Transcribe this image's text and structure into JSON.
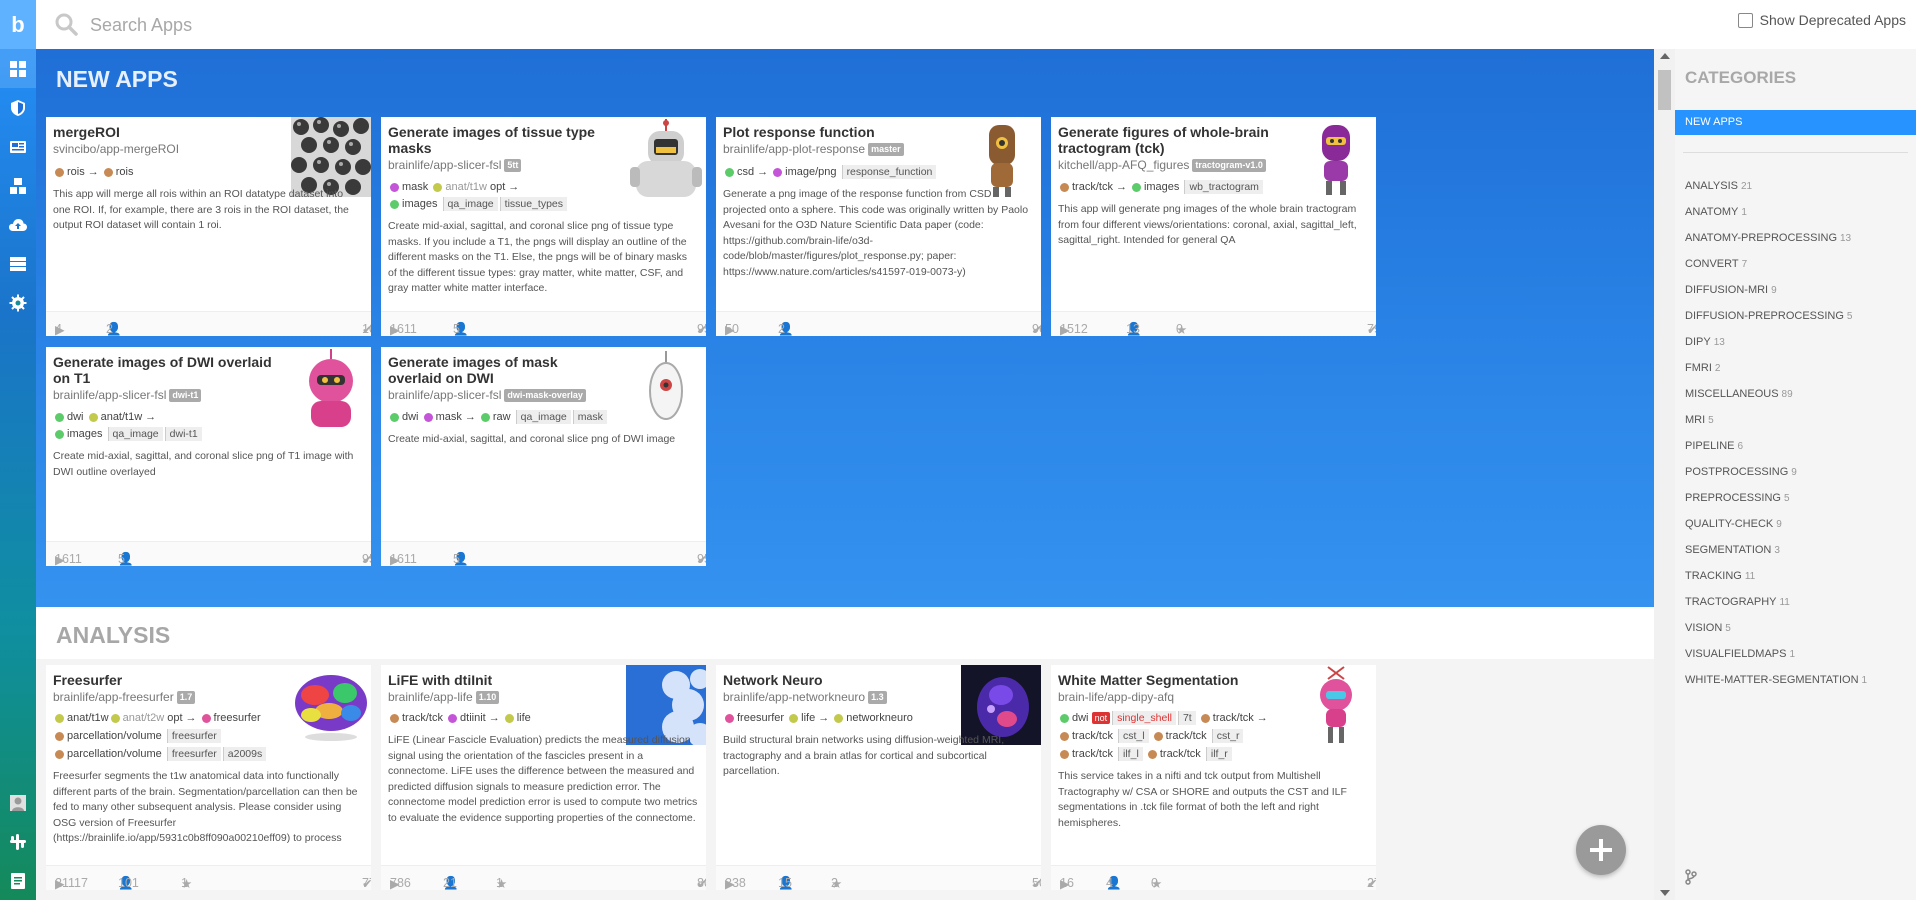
{
  "search": {
    "placeholder": "Search Apps"
  },
  "deprecated_label": "Show Deprecated Apps",
  "sections": {
    "new_apps": "NEW APPS",
    "analysis": "ANALYSIS"
  },
  "categories": {
    "title": "CATEGORIES",
    "selected": "NEW APPS",
    "items": [
      {
        "name": "ANALYSIS",
        "count": "21"
      },
      {
        "name": "ANATOMY",
        "count": "1"
      },
      {
        "name": "ANATOMY-PREPROCESSING",
        "count": "13"
      },
      {
        "name": "CONVERT",
        "count": "7"
      },
      {
        "name": "DIFFUSION-MRI",
        "count": "9"
      },
      {
        "name": "DIFFUSION-PREPROCESSING",
        "count": "5"
      },
      {
        "name": "DIPY",
        "count": "13"
      },
      {
        "name": "FMRI",
        "count": "2"
      },
      {
        "name": "MISCELLANEOUS",
        "count": "89"
      },
      {
        "name": "MRI",
        "count": "5"
      },
      {
        "name": "PIPELINE",
        "count": "6"
      },
      {
        "name": "POSTPROCESSING",
        "count": "9"
      },
      {
        "name": "PREPROCESSING",
        "count": "5"
      },
      {
        "name": "QUALITY-CHECK",
        "count": "9"
      },
      {
        "name": "SEGMENTATION",
        "count": "3"
      },
      {
        "name": "TRACKING",
        "count": "11"
      },
      {
        "name": "TRACTOGRAPHY",
        "count": "11"
      },
      {
        "name": "VISION",
        "count": "5"
      },
      {
        "name": "VISUALFIELDMAPS",
        "count": "1"
      },
      {
        "name": "WHITE-MATTER-SEGMENTATION",
        "count": "1"
      }
    ]
  },
  "new_apps": [
    {
      "name": "mergeROI",
      "repo": "svincibo/app-mergeROI",
      "tag": "",
      "io1": {
        "a": "rois",
        "b": "rois"
      },
      "desc": "This app will merge all rois within an ROI datatype dataset into one ROI. If, for example, there are 3 rois in the ROI dataset, the output ROI dataset will contain 1 roi.",
      "runs": "4",
      "users": "2",
      "stars": "",
      "pct": "100.0%"
    },
    {
      "name": "Generate images of tissue type masks",
      "repo": "brainlife/app-slicer-fsl",
      "tag": "5tt",
      "io1": {
        "a": "mask",
        "b": "anat/t1w",
        "opt": "opt"
      },
      "io2": {
        "a": "images",
        "t1": "qa_image",
        "t2": "tissue_types"
      },
      "desc": "Create mid-axial, sagittal, and coronal slice png of tissue type masks. If you include a T1, the pngs will display an outline of the different masks on the T1. Else, the pngs will be of binary masks of the different tissue types: gray matter, white matter, CSF, and gray matter white matter interface.",
      "runs": "1611",
      "users": "5",
      "stars": "",
      "pct": "95.0%"
    },
    {
      "name": "Plot response function",
      "repo": "brainlife/app-plot-response",
      "tag": "master",
      "io1": {
        "a": "csd",
        "b": "image/png",
        "t1": "response_function"
      },
      "desc": "Generate a png image of the response function from CSD projected onto a sphere. This code was originally written by Paolo Avesani for the O3D Nature Scientific Data paper (code: https://github.com/brain-life/o3d-code/blob/master/figures/plot_response.py; paper: https://www.nature.com/articles/s41597-019-0073-y)",
      "runs": "50",
      "users": "2",
      "stars": "",
      "pct": "96.0%"
    },
    {
      "name": "Generate figures of whole-brain tractogram (tck)",
      "repo": "kitchell/app-AFQ_figures",
      "tag": "tractogram-v1.0",
      "io1": {
        "a": "track/tck",
        "b": "images",
        "t1": "wb_tractogram"
      },
      "desc": "This app will generate png images of the whole brain tractogram from four different views/orientations: coronal, axial, sagittal_left, sagittal_right. Intended for general QA",
      "runs": "1512",
      "users": "13",
      "stars": "0",
      "pct": "79.6%"
    },
    {
      "name": "Generate images of DWI overlaid on T1",
      "repo": "brainlife/app-slicer-fsl",
      "tag": "dwi-t1",
      "io1": {
        "a": "dwi",
        "b": "anat/t1w"
      },
      "io2": {
        "a": "images",
        "t1": "qa_image",
        "t2": "dwi-t1"
      },
      "desc": "Create mid-axial, sagittal, and coronal slice png of T1 image with DWI outline overlayed",
      "runs": "1611",
      "users": "5",
      "stars": "",
      "pct": "95.0%"
    },
    {
      "name": "Generate images of mask overlaid on DWI",
      "repo": "brainlife/app-slicer-fsl",
      "tag": "dwi-mask-overlay",
      "io1": {
        "a": "dwi",
        "b": "mask",
        "c": "raw",
        "t1": "qa_image",
        "t2": "mask"
      },
      "desc": "Create mid-axial, sagittal, and coronal slice png of DWI image",
      "runs": "1611",
      "users": "5",
      "stars": "",
      "pct": "95.0%"
    }
  ],
  "analysis_apps": [
    {
      "name": "Freesurfer",
      "repo": "brainlife/app-freesurfer",
      "tag": "1.7",
      "io1": {
        "a": "anat/t1w",
        "b": "anat/t2w",
        "opt": "opt",
        "c": "freesurfer"
      },
      "io2": {
        "a": "parcellation/volume",
        "t1": "freesurfer"
      },
      "io3": {
        "a": "parcellation/volume",
        "t1": "freesurfer",
        "t2": "a2009s"
      },
      "desc": "Freesurfer segments the t1w anatomical data into functionally different parts of the brain. Segmentation/parcellation can then be fed to many other subsequent analysis. Please consider using OSG version of Freesurfer (https://brainlife.io/app/5931c0b8ff090a00210eff09) to process",
      "runs": "21117",
      "users": "101",
      "stars": "1",
      "pct": "77.4%"
    },
    {
      "name": "LiFE with dtiInit",
      "repo": "brainlife/app-life",
      "tag": "1.10",
      "io1": {
        "a": "track/tck",
        "b": "dtiinit",
        "c": "life"
      },
      "desc": "LiFE (Linear Fascicle Evaluation) predicts the measured diffusion signal using the orientation of the fascicles present in a connectome. LiFE uses the difference between the measured and predicted diffusion signals to measure prediction error. The connectome model prediction error is used to compute two metrics to evaluate the evidence supporting properties of the connectome.",
      "runs": "786",
      "users": "21",
      "stars": "1",
      "pct": "80.0%"
    },
    {
      "name": "Network Neuro",
      "repo": "brainlife/app-networkneuro",
      "tag": "1.3",
      "io1": {
        "a": "freesurfer",
        "b": "life",
        "c": "networkneuro"
      },
      "desc": "Build structural brain networks using diffusion-weighted MRI, tractography and a brain atlas for cortical and subcortical parcellation.",
      "runs": "338",
      "users": "15",
      "stars": "2",
      "pct": "50.8%"
    },
    {
      "name": "White Matter Segmentation",
      "repo": "brain-life/app-dipy-afq",
      "tag": "",
      "io1": {
        "a": "dwi",
        "not": "not",
        "ns": "single_shell",
        "t1": "7t",
        "c": "track/tck"
      },
      "io2": {
        "a": "track/tck",
        "t1": "cst_l",
        "b": "track/tck",
        "t2": "cst_r"
      },
      "io3": {
        "a": "track/tck",
        "t1": "ilf_l",
        "b": "track/tck",
        "t2": "ilf_r"
      },
      "desc": "This service takes in a nifti and tck output from Multishell Tractography w/ CSA or SHORE and outputs the CST and ILF segmentations in .tck file format of both the left and right hemispheres.",
      "runs": "16",
      "users": "4",
      "stars": "0",
      "pct": "27.3%"
    }
  ]
}
